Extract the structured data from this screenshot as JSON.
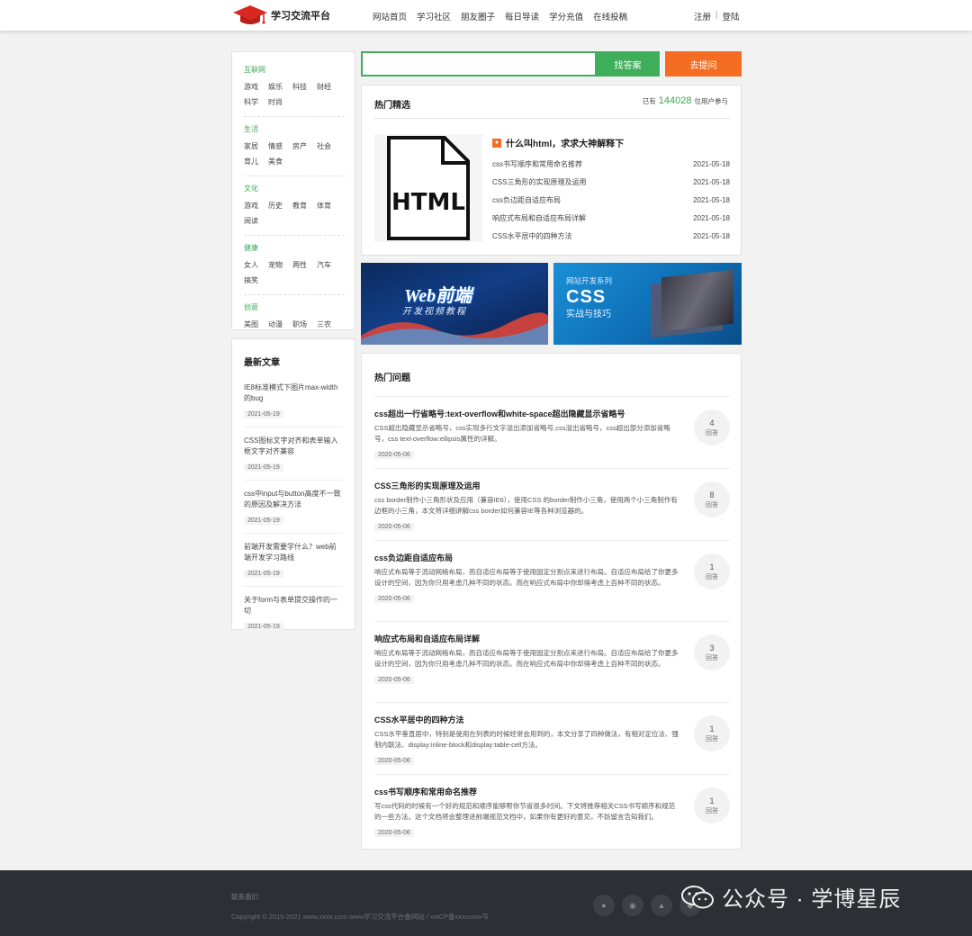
{
  "header": {
    "logo_text": "学习交流平台",
    "nav": [
      "网站首页",
      "学习社区",
      "朋友圈子",
      "每日导读",
      "学分充值",
      "在线投稿"
    ],
    "register": "注册",
    "separator": "|",
    "login": "登陆"
  },
  "categories": [
    {
      "title": "互联网",
      "items": [
        "游戏",
        "娱乐",
        "科技",
        "财经",
        "科学",
        "时尚"
      ]
    },
    {
      "title": "生活",
      "items": [
        "家居",
        "情感",
        "房产",
        "社会",
        "育儿",
        "美食"
      ]
    },
    {
      "title": "文化",
      "items": [
        "游戏",
        "历史",
        "教育",
        "体育",
        "阅读"
      ]
    },
    {
      "title": "健康",
      "items": [
        "女人",
        "宠物",
        "两性",
        "汽车",
        "搞笑"
      ]
    },
    {
      "title": "创意",
      "items": [
        "美图",
        "动漫",
        "职场",
        "三农"
      ]
    }
  ],
  "latest": {
    "title": "最新文章",
    "items": [
      {
        "text": "IE8标准模式下图片max-width的bug",
        "date": "2021-05-19"
      },
      {
        "text": "CSS图标文字对齐和表单输入框文字对齐兼容",
        "date": "2021-05-19"
      },
      {
        "text": "css中input与button高度不一致的原因及解决方法",
        "date": "2021-05-19"
      },
      {
        "text": "前端开发需要学什么？web前端开发学习路线",
        "date": "2021-05-19"
      },
      {
        "text": "关于form与表单提交操作的一切",
        "date": "2021-05-19"
      }
    ]
  },
  "search": {
    "placeholder": "",
    "find_label": "找答案",
    "ask_label": "去提问"
  },
  "hot": {
    "title": "热门精选",
    "stat_prefix": "已有",
    "stat_number": "144028",
    "stat_suffix": "位用户参与",
    "feature_title": "什么叫html，求求大神解释下",
    "thumb_text": "HTML",
    "items": [
      {
        "text": "css书写顺序和常用命名推荐",
        "date": "2021-05-18"
      },
      {
        "text": "CSS三角形的实现原理及运用",
        "date": "2021-05-18"
      },
      {
        "text": "css负边距自适应布局",
        "date": "2021-05-18"
      },
      {
        "text": "响应式布局和自适应布局详解",
        "date": "2021-05-18"
      },
      {
        "text": "CSS水平居中的四种方法",
        "date": "2021-05-18"
      }
    ]
  },
  "banners": {
    "b1_main": "Web前端",
    "b1_sub": "开发视频教程",
    "b2_small": "网站开发系列",
    "b2_main": "CSS",
    "b2_sub": "实战与技巧"
  },
  "questions": {
    "title": "热门问题",
    "answer_label": "回答",
    "items": [
      {
        "title": "css超出一行省略号:text-overflow和white-space超出隐藏显示省略号",
        "desc": "CSS超出隐藏显示省略号，css实现多行文字溢出添加省略号,css溢出省略号，css超出部分添加省略号，css text-overflow:ellipsis属性的详解。",
        "date": "2020-05-06",
        "answers": "4"
      },
      {
        "title": "CSS三角形的实现原理及运用",
        "desc": "css border制作小三角形状及应用（兼容IE6），使用CSS 的border制作小三角，使用两个小三角制作有边框的小三角，本文将详细讲解css border如何兼容IE等各种浏览器的。",
        "date": "2020-05-06",
        "answers": "8"
      },
      {
        "title": "css负边距自适应布局",
        "desc": "响应式布局等于流动网格布局，而自适应布局等于使用固定分割点来进行布局。自适应布局给了你更多设计的空间，因为你只用考虑几种不同的状态。而在响应式布局中你却得考虑上百种不同的状态。",
        "date": "2020-05-06",
        "answers": "1"
      },
      {
        "title": "响应式布局和自适应布局详解",
        "desc": "响应式布局等于流动网格布局，而自适应布局等于使用固定分割点来进行布局。自适应布局给了你更多设计的空间，因为你只用考虑几种不同的状态。而在响应式布局中你却得考虑上百种不同的状态。",
        "date": "2020-05-06",
        "answers": "3"
      },
      {
        "title": "CSS水平居中的四种方法",
        "desc": "CSS水平垂直居中，特别是使用在列表的时候经常会用到的，本文分享了四种做法，有相对定位法、强制内联法、display:inline-block和display:table-cell方法。",
        "date": "2020-05-06",
        "answers": "1"
      },
      {
        "title": "css书写顺序和常用命名推荐",
        "desc": "写css代码的时候有一个好的规范和顺序能够帮你节省很多时间。下文将推荐相关CSS书写顺序和规范的一些方法。这个文档将会整理进前端规范文档中，如果你有更好的意见，不妨留言告知我们。",
        "date": "2020-05-06",
        "answers": "1"
      }
    ]
  },
  "footer": {
    "contact": "联系我们",
    "copyright": "Copyright © 2015-2021 www.xxxx.com www学习交流平台备网站 / xxICP备xxxxxxxx号",
    "icons": [
      "wechat-icon",
      "weibo-icon",
      "android-icon",
      "apple-icon"
    ],
    "watermark": "公众号 · 学博星辰"
  },
  "colors": {
    "primary_green": "#3fae5a",
    "accent_orange": "#f46d22",
    "footer_bg": "#2d2f34",
    "logo_red": "#d8281f"
  }
}
